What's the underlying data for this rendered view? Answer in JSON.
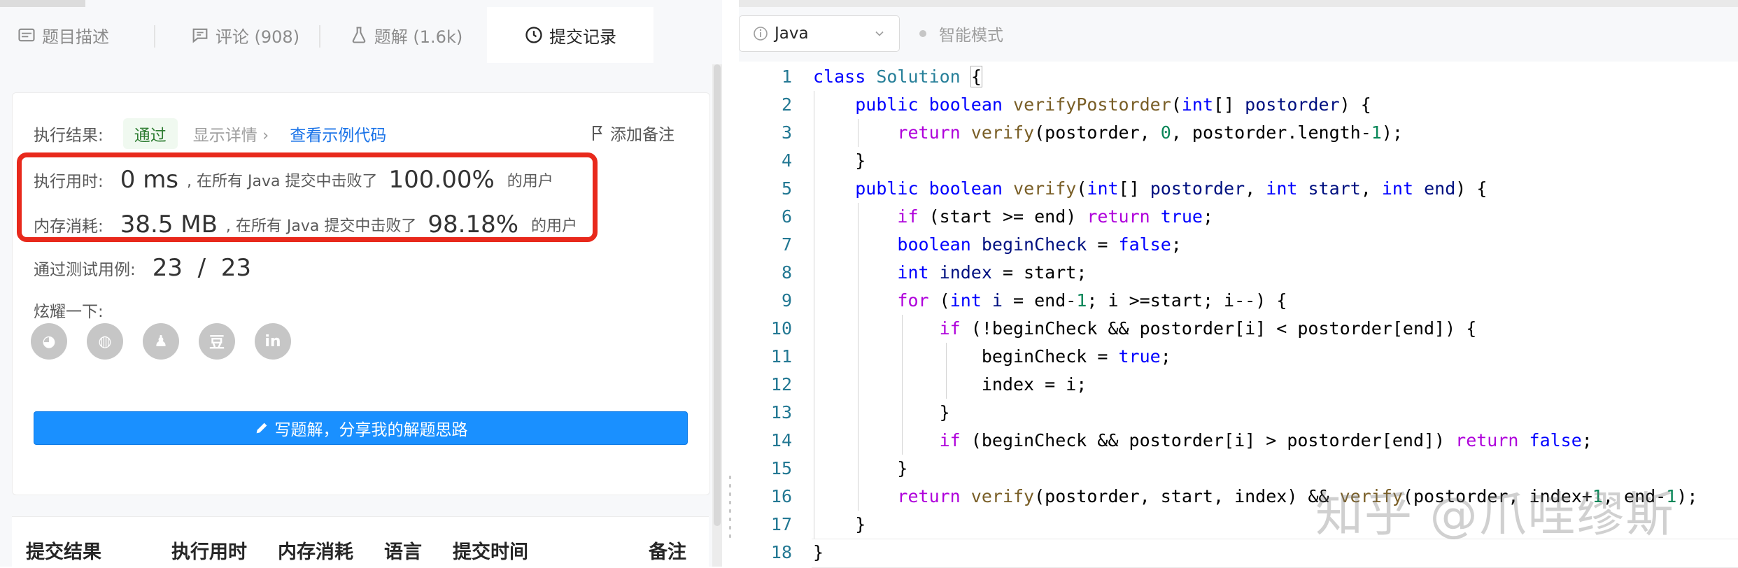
{
  "tabs": [
    {
      "label": "题目描述",
      "icon": "description-icon"
    },
    {
      "label": "评论 (908)",
      "icon": "comment-icon"
    },
    {
      "label": "题解 (1.6k)",
      "icon": "flask-icon"
    },
    {
      "label": "提交记录",
      "icon": "clock-icon"
    }
  ],
  "result": {
    "label": "执行结果:",
    "status": "通过",
    "details_link": "显示详情 ›",
    "example_link": "查看示例代码",
    "add_note": "添加备注"
  },
  "runtime": {
    "label": "执行用时:",
    "value": "0 ms",
    "text": ", 在所有 Java 提交中击败了",
    "percent": "100.00%",
    "suffix": "的用户"
  },
  "memory": {
    "label": "内存消耗:",
    "value": "38.5 MB",
    "text": ", 在所有 Java 提交中击败了",
    "percent": "98.18%",
    "suffix": "的用户"
  },
  "tests": {
    "label": "通过测试用例:",
    "value": "23  /  23"
  },
  "share": {
    "label": "炫耀一下:",
    "icons": [
      "wechat-icon",
      "weibo-icon",
      "qq-icon",
      "douban-icon",
      "linkedin-icon"
    ],
    "glyphs": [
      "◕",
      "◍",
      "♟",
      "豆",
      "in"
    ]
  },
  "write_button": "写题解，分享我的解题思路",
  "table_headers": [
    "提交结果",
    "执行用时",
    "内存消耗",
    "语言",
    "提交时间",
    "备注"
  ],
  "toolbar": {
    "language": "Java",
    "smart_mode": "智能模式"
  },
  "code_lines": [
    "1",
    "2",
    "3",
    "4",
    "5",
    "6",
    "7",
    "8",
    "9",
    "10",
    "11",
    "12",
    "13",
    "14",
    "15",
    "16",
    "17",
    "18"
  ],
  "watermark": "知乎 @爪哇缪斯"
}
